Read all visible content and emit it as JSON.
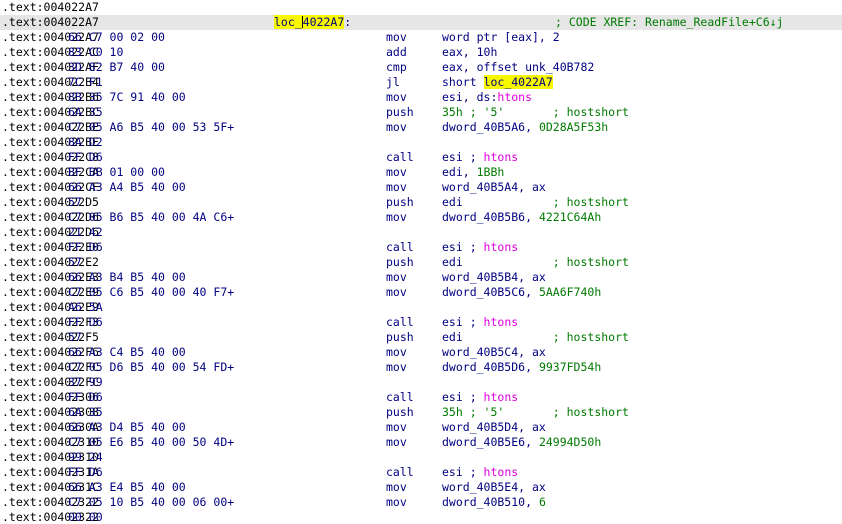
{
  "label": {
    "prefix": "loc_",
    "rest": "4022A7",
    "suffix": ":"
  },
  "xref_comment": "; CODE XREF: Rename_ReadFile+C6↓j",
  "rows": [
    {
      "addr": ".text:004022A7",
      "bytes": "",
      "mnem": "",
      "ops": []
    },
    {
      "addr": ".text:004022A7",
      "bytes": "",
      "mnem": "",
      "ops": [],
      "selected": true,
      "label_row": true
    },
    {
      "addr": ".text:004022A7",
      "bytes": "66 C7 00 02 00",
      "mnem": "mov",
      "ops": [
        {
          "t": "word ptr [eax], 2"
        }
      ]
    },
    {
      "addr": ".text:004022AC",
      "bytes": "83 C0 10",
      "mnem": "add",
      "ops": [
        {
          "t": "eax, 10h"
        }
      ]
    },
    {
      "addr": ".text:004022AF",
      "bytes": "3D 82 B7 40 00",
      "mnem": "cmp",
      "ops": [
        {
          "t": "eax, offset unk_40B782"
        }
      ]
    },
    {
      "addr": ".text:004022B4",
      "bytes": "7C F1",
      "mnem": "jl",
      "ops": [
        {
          "t": "short "
        },
        {
          "t": "loc_4022A7",
          "k": "hl"
        }
      ]
    },
    {
      "addr": ".text:004022B6",
      "bytes": "8B 35 7C 91 40 00",
      "mnem": "mov",
      "ops": [
        {
          "t": "esi, ds:"
        },
        {
          "t": "htons",
          "k": "mag"
        }
      ]
    },
    {
      "addr": ".text:004022BC",
      "bytes": "6A 35",
      "mnem": "push",
      "ops": [
        {
          "t": "35h",
          "k": "num"
        },
        {
          "t": " ; '5'       ; hostshort",
          "k": "cmt"
        }
      ]
    },
    {
      "addr": ".text:004022BE",
      "bytes": "C7 05 A6 B5 40 00 53 5F+",
      "mnem": "mov",
      "ops": [
        {
          "t": "dword_40B5A6, "
        },
        {
          "t": "0D28A5F53h",
          "k": "num"
        }
      ]
    },
    {
      "addr": ".text:004022BE",
      "bytes": "8A D2",
      "mnem": "",
      "ops": []
    },
    {
      "addr": ".text:004022C8",
      "bytes": "FF D6",
      "mnem": "call",
      "ops": [
        {
          "t": "esi ; ",
          "k": ""
        },
        {
          "t": "htons",
          "k": "mag"
        }
      ]
    },
    {
      "addr": ".text:004022CA",
      "bytes": "BF BB 01 00 00",
      "mnem": "mov",
      "ops": [
        {
          "t": "edi, "
        },
        {
          "t": "1BBh",
          "k": "num"
        }
      ]
    },
    {
      "addr": ".text:004022CF",
      "bytes": "66 A3 A4 B5 40 00",
      "mnem": "mov",
      "ops": [
        {
          "t": "word_40B5A4, ax"
        }
      ]
    },
    {
      "addr": ".text:004022D5",
      "bytes": "57",
      "mnem": "push",
      "ops": [
        {
          "t": "edi"
        },
        {
          "t": "             ; hostshort",
          "k": "cmt"
        }
      ]
    },
    {
      "addr": ".text:004022D6",
      "bytes": "C7 05 B6 B5 40 00 4A C6+",
      "mnem": "mov",
      "ops": [
        {
          "t": "dword_40B5B6, "
        },
        {
          "t": "4221C64Ah",
          "k": "num"
        }
      ]
    },
    {
      "addr": ".text:004022D6",
      "bytes": "21 42",
      "mnem": "",
      "ops": []
    },
    {
      "addr": ".text:004022E0",
      "bytes": "FF D6",
      "mnem": "call",
      "ops": [
        {
          "t": "esi ; "
        },
        {
          "t": "htons",
          "k": "mag"
        }
      ]
    },
    {
      "addr": ".text:004022E2",
      "bytes": "57",
      "mnem": "push",
      "ops": [
        {
          "t": "edi"
        },
        {
          "t": "             ; hostshort",
          "k": "cmt"
        }
      ]
    },
    {
      "addr": ".text:004022E3",
      "bytes": "66 A3 B4 B5 40 00",
      "mnem": "mov",
      "ops": [
        {
          "t": "word_40B5B4, ax"
        }
      ]
    },
    {
      "addr": ".text:004022E9",
      "bytes": "C7 05 C6 B5 40 00 40 F7+",
      "mnem": "mov",
      "ops": [
        {
          "t": "dword_40B5C6, "
        },
        {
          "t": "5AA6F740h",
          "k": "num"
        }
      ]
    },
    {
      "addr": ".text:004022E9",
      "bytes": "A6 5A",
      "mnem": "",
      "ops": []
    },
    {
      "addr": ".text:004022F3",
      "bytes": "FF D6",
      "mnem": "call",
      "ops": [
        {
          "t": "esi ; "
        },
        {
          "t": "htons",
          "k": "mag"
        }
      ]
    },
    {
      "addr": ".text:004022F5",
      "bytes": "57",
      "mnem": "push",
      "ops": [
        {
          "t": "edi"
        },
        {
          "t": "             ; hostshort",
          "k": "cmt"
        }
      ]
    },
    {
      "addr": ".text:004022F6",
      "bytes": "66 A3 C4 B5 40 00",
      "mnem": "mov",
      "ops": [
        {
          "t": "word_40B5C4, ax"
        }
      ]
    },
    {
      "addr": ".text:004022FC",
      "bytes": "C7 05 D6 B5 40 00 54 FD+",
      "mnem": "mov",
      "ops": [
        {
          "t": "dword_40B5D6, "
        },
        {
          "t": "9937FD54h",
          "k": "num"
        }
      ]
    },
    {
      "addr": ".text:004022FC",
      "bytes": "37 99",
      "mnem": "",
      "ops": []
    },
    {
      "addr": ".text:00402306",
      "bytes": "FF D6",
      "mnem": "call",
      "ops": [
        {
          "t": "esi ; "
        },
        {
          "t": "htons",
          "k": "mag"
        }
      ]
    },
    {
      "addr": ".text:00402308",
      "bytes": "6A 35",
      "mnem": "push",
      "ops": [
        {
          "t": "35h",
          "k": "num"
        },
        {
          "t": " ; '5'       ; hostshort",
          "k": "cmt"
        }
      ]
    },
    {
      "addr": ".text:0040230A",
      "bytes": "66 A3 D4 B5 40 00",
      "mnem": "mov",
      "ops": [
        {
          "t": "word_40B5D4, ax"
        }
      ]
    },
    {
      "addr": ".text:00402310",
      "bytes": "C7 05 E6 B5 40 00 50 4D+",
      "mnem": "mov",
      "ops": [
        {
          "t": "dword_40B5E6, "
        },
        {
          "t": "24994D50h",
          "k": "num"
        }
      ]
    },
    {
      "addr": ".text:00402310",
      "bytes": "99 24",
      "mnem": "",
      "ops": []
    },
    {
      "addr": ".text:0040231A",
      "bytes": "FF D6",
      "mnem": "call",
      "ops": [
        {
          "t": "esi ; "
        },
        {
          "t": "htons",
          "k": "mag"
        }
      ]
    },
    {
      "addr": ".text:0040231C",
      "bytes": "66 A3 E4 B5 40 00",
      "mnem": "mov",
      "ops": [
        {
          "t": "word_40B5E4, ax"
        }
      ]
    },
    {
      "addr": ".text:00402322",
      "bytes": "C7 05 10 B5 40 00 06 00+",
      "mnem": "mov",
      "ops": [
        {
          "t": "dword_40B510, "
        },
        {
          "t": "6",
          "k": "num"
        }
      ]
    },
    {
      "addr": ".text:00402322",
      "bytes": "00 00",
      "mnem": "",
      "ops": []
    }
  ]
}
